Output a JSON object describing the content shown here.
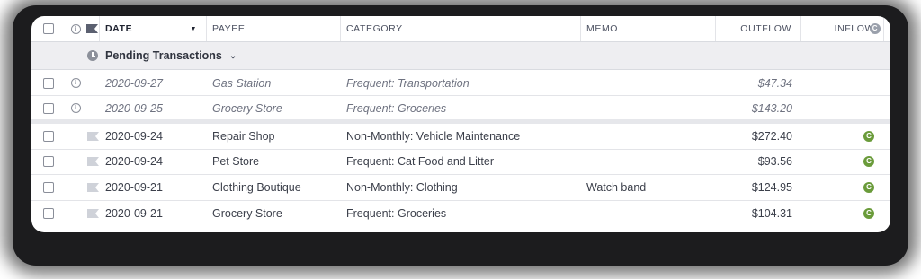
{
  "header": {
    "date": "DATE",
    "payee": "PAYEE",
    "category": "CATEGORY",
    "memo": "MEMO",
    "outflow": "OUTFLOW",
    "inflow": "INFLOW"
  },
  "pending": {
    "label": "Pending Transactions",
    "rows": [
      {
        "date": "2020-09-27",
        "payee": "Gas Station",
        "category": "Frequent: Transportation",
        "memo": "",
        "outflow": "$47.34",
        "inflow": ""
      },
      {
        "date": "2020-09-25",
        "payee": "Grocery Store",
        "category": "Frequent: Groceries",
        "memo": "",
        "outflow": "$143.20",
        "inflow": ""
      }
    ]
  },
  "transactions": [
    {
      "date": "2020-09-24",
      "payee": "Repair Shop",
      "category": "Non-Monthly: Vehicle Maintenance",
      "memo": "",
      "outflow": "$272.40",
      "inflow": ""
    },
    {
      "date": "2020-09-24",
      "payee": "Pet Store",
      "category": "Frequent: Cat Food and Litter",
      "memo": "",
      "outflow": "$93.56",
      "inflow": ""
    },
    {
      "date": "2020-09-21",
      "payee": "Clothing Boutique",
      "category": "Non-Monthly: Clothing",
      "memo": "Watch band",
      "outflow": "$124.95",
      "inflow": ""
    },
    {
      "date": "2020-09-21",
      "payee": "Grocery Store",
      "category": "Frequent: Groceries",
      "memo": "",
      "outflow": "$104.31",
      "inflow": ""
    }
  ],
  "icons": {
    "cleared": "C",
    "info": "i"
  },
  "colors": {
    "cleared_green": "#6a9b3a",
    "pending_bar": "#eeeef1"
  }
}
